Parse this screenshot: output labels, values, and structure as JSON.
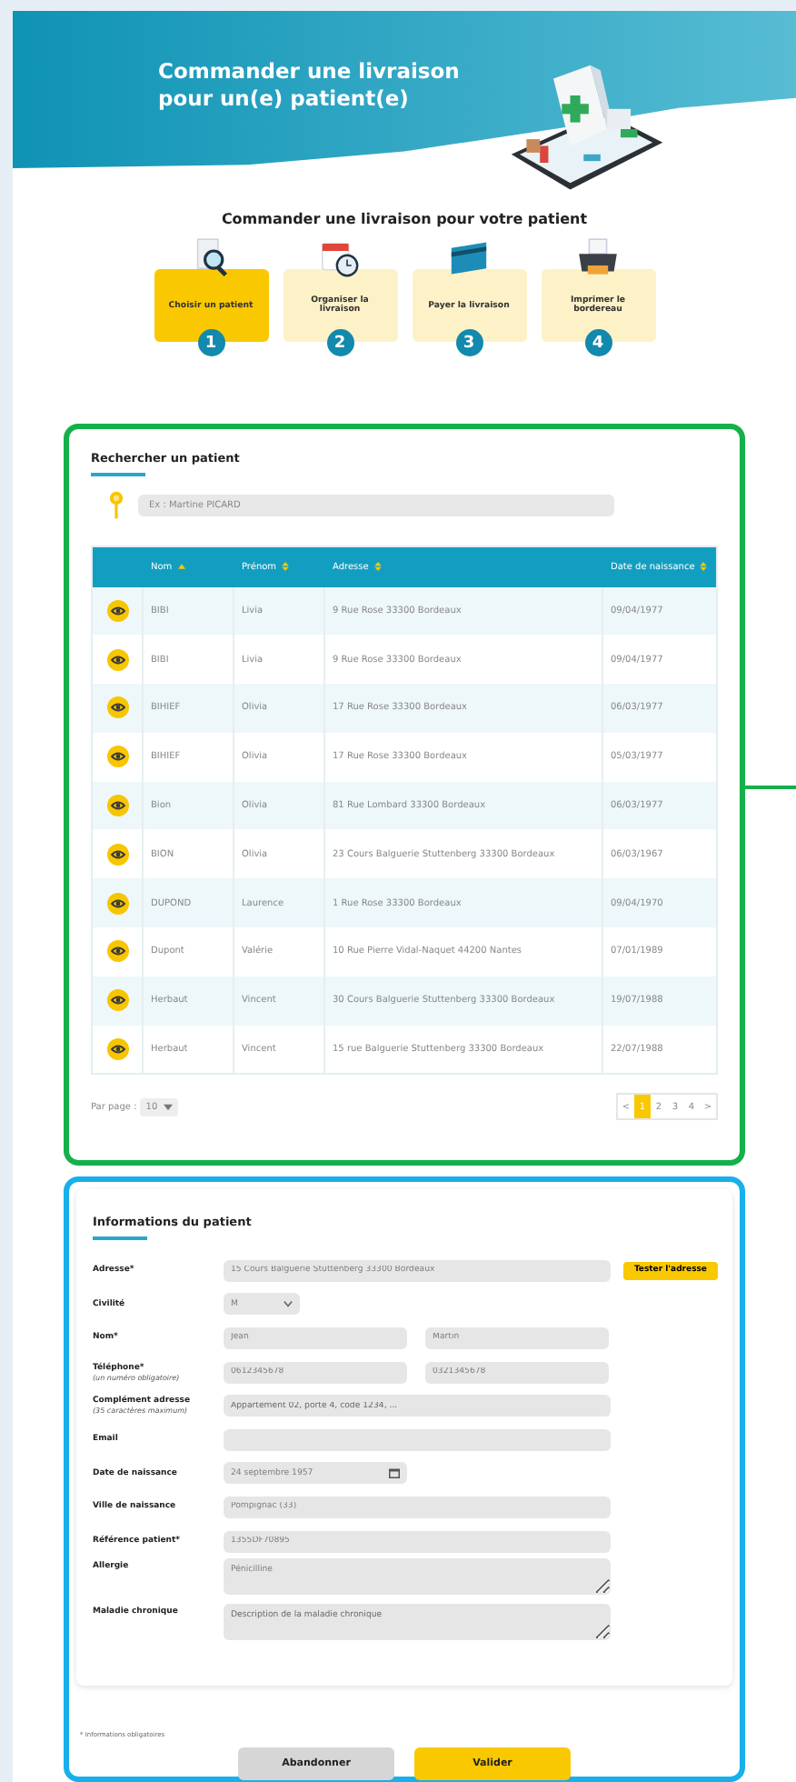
{
  "header": {
    "title_lines": [
      "Commander une livraison",
      "pour un(e) patient(e)"
    ]
  },
  "steps_title": "Commander une livraison pour votre patient",
  "steps": [
    {
      "label": "Choisir un patient",
      "number": "1",
      "selected": true,
      "kind": "search"
    },
    {
      "label": "Organiser la livraison",
      "number": "2",
      "selected": false,
      "kind": "calendar"
    },
    {
      "label": "Payer la livraison",
      "number": "3",
      "selected": false,
      "kind": "card"
    },
    {
      "label": "Imprimer le bordereau",
      "number": "4",
      "selected": false,
      "kind": "printer"
    }
  ],
  "search_panel": {
    "title": "Rechercher un patient",
    "search": {
      "placeholder": "Ex : Martine PICARD"
    },
    "table": {
      "columns": [
        {
          "label": "Nom",
          "sorted": true
        },
        {
          "label": "Prénom",
          "sorted": false
        },
        {
          "label": "Adresse",
          "sorted": false
        },
        {
          "label": "Date de naissance",
          "sorted": false
        }
      ],
      "rows": [
        [
          "BIBI",
          "Livia",
          "9 Rue Rose 33300 Bordeaux",
          "09/04/1977"
        ],
        [
          "BIBI",
          "Livia",
          "9 Rue Rose 33300 Bordeaux",
          "09/04/1977"
        ],
        [
          "BIHIEF",
          "Olivia",
          "17 Rue Rose 33300 Bordeaux",
          "06/03/1977"
        ],
        [
          "BIHIEF",
          "Olivia",
          "17 Rue Rose 33300 Bordeaux",
          "05/03/1977"
        ],
        [
          "Bion",
          "Olivia",
          "81 Rue Lombard 33300 Bordeaux",
          "06/03/1977"
        ],
        [
          "BION",
          "Olivia",
          "23 Cours Balguerie Stuttenberg 33300 Bordeaux",
          "06/03/1967"
        ],
        [
          "DUPOND",
          "Laurence",
          "1 Rue Rose 33300 Bordeaux",
          "09/04/1970"
        ],
        [
          "Dupont",
          "Valérie",
          "10 Rue Pierre Vidal-Naquet 44200 Nantes",
          "07/01/1989"
        ],
        [
          "Herbaut",
          "Vincent",
          "30 Cours Balguerie Stuttenberg 33300 Bordeaux",
          "19/07/1988"
        ],
        [
          "Herbaut",
          "Vincent",
          "15 rue Balguerie Stuttenberg 33300 Bordeaux",
          "22/07/1988"
        ]
      ]
    },
    "per_page": {
      "label": "Par page :",
      "value": "10"
    },
    "pagination": [
      {
        "label": "<",
        "selected": false
      },
      {
        "label": "1",
        "selected": true
      },
      {
        "label": "2",
        "selected": false
      },
      {
        "label": "3",
        "selected": false
      },
      {
        "label": "4",
        "selected": false
      },
      {
        "label": ">",
        "selected": false
      }
    ]
  },
  "patient_panel": {
    "title": "Informations du patient",
    "rows": [
      {
        "kind": "text",
        "label": "Adresse*",
        "value": "15 Cours Balguerie Stuttenberg 33300 Bordeaux",
        "button": "Tester l'adresse"
      },
      {
        "kind": "select",
        "label": "Civilité",
        "value": "M"
      },
      {
        "kind": "pair",
        "label": "Nom*",
        "values": [
          "Jean",
          "Martin"
        ]
      },
      {
        "kind": "pair",
        "label": "Téléphone*",
        "hint": "(un numéro obligatoire)",
        "values": [
          "0612345678",
          "0321345678"
        ]
      },
      {
        "kind": "text",
        "label": "Complément adresse",
        "hint": "(35 caractères maximum)",
        "placeholder": "Appartement 02, porte 4, code 1234, ..."
      },
      {
        "kind": "text",
        "label": "Email"
      },
      {
        "kind": "date",
        "label": "Date de naissance",
        "value": "24 septembre 1957"
      },
      {
        "kind": "text",
        "label": "Ville de naissance",
        "value": "Pompignac (33)"
      },
      {
        "kind": "text",
        "label": "Référence patient*",
        "value": "1355DF70895"
      },
      {
        "kind": "textarea",
        "label": "Allergie",
        "value": "Pénicilline"
      },
      {
        "kind": "textarea",
        "label": "Maladie chronique",
        "placeholder": "Description de la maladie chronique"
      }
    ],
    "footnote": "* Informations obligatoires",
    "buttons": [
      {
        "label": "Abandonner",
        "kind": "secondary"
      },
      {
        "label": "Valider",
        "kind": "primary"
      }
    ]
  }
}
